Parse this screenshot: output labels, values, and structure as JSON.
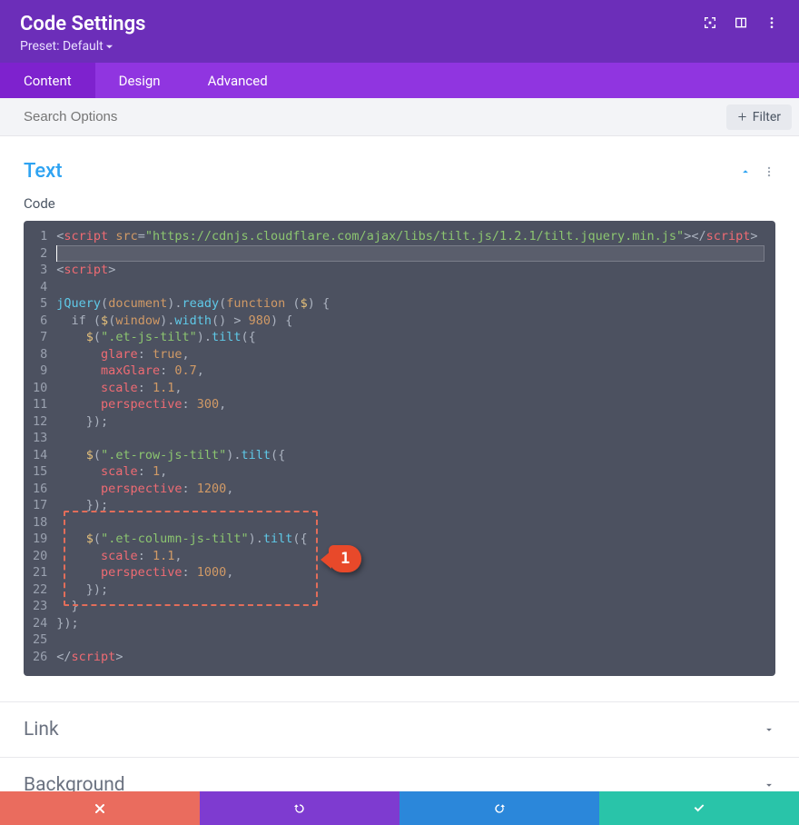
{
  "header": {
    "title": "Code Settings",
    "preset_label": "Preset: Default"
  },
  "tabs": [
    {
      "label": "Content",
      "active": true
    },
    {
      "label": "Design",
      "active": false
    },
    {
      "label": "Advanced",
      "active": false
    }
  ],
  "search": {
    "placeholder": "Search Options",
    "filter_label": "Filter"
  },
  "section_text": {
    "title": "Text",
    "code_label": "Code"
  },
  "editor": {
    "line_count": 26,
    "highlighted_line": 2,
    "lines": [
      [
        {
          "t": "<",
          "c": "gray"
        },
        {
          "t": "script",
          "c": "red"
        },
        {
          "t": " ",
          "c": "gray"
        },
        {
          "t": "src",
          "c": "orange"
        },
        {
          "t": "=",
          "c": "gray"
        },
        {
          "t": "\"https://cdnjs.cloudflare.com/ajax/libs/tilt.js/1.2.1/tilt.jquery.min.js\"",
          "c": "green"
        },
        {
          "t": "></",
          "c": "gray"
        },
        {
          "t": "script",
          "c": "red"
        },
        {
          "t": ">",
          "c": "gray"
        }
      ],
      [],
      [
        {
          "t": "<",
          "c": "gray"
        },
        {
          "t": "script",
          "c": "red"
        },
        {
          "t": ">",
          "c": "gray"
        }
      ],
      [],
      [
        {
          "t": "jQuery",
          "c": "lblue"
        },
        {
          "t": "(",
          "c": "gray"
        },
        {
          "t": "document",
          "c": "orange"
        },
        {
          "t": ").",
          "c": "gray"
        },
        {
          "t": "ready",
          "c": "lblue"
        },
        {
          "t": "(",
          "c": "gray"
        },
        {
          "t": "function",
          "c": "orange"
        },
        {
          "t": " (",
          "c": "gray"
        },
        {
          "t": "$",
          "c": "yellow"
        },
        {
          "t": ") {",
          "c": "gray"
        }
      ],
      [
        {
          "t": "  if ",
          "c": "gray"
        },
        {
          "t": "(",
          "c": "gray"
        },
        {
          "t": "$",
          "c": "yellow"
        },
        {
          "t": "(",
          "c": "gray"
        },
        {
          "t": "window",
          "c": "orange"
        },
        {
          "t": ").",
          "c": "gray"
        },
        {
          "t": "width",
          "c": "lblue"
        },
        {
          "t": "() > ",
          "c": "gray"
        },
        {
          "t": "980",
          "c": "orange"
        },
        {
          "t": ") {",
          "c": "gray"
        }
      ],
      [
        {
          "t": "    ",
          "c": "gray"
        },
        {
          "t": "$",
          "c": "yellow"
        },
        {
          "t": "(",
          "c": "gray"
        },
        {
          "t": "\".et-js-tilt\"",
          "c": "green"
        },
        {
          "t": ").",
          "c": "gray"
        },
        {
          "t": "tilt",
          "c": "lblue"
        },
        {
          "t": "({",
          "c": "gray"
        }
      ],
      [
        {
          "t": "      ",
          "c": "gray"
        },
        {
          "t": "glare",
          "c": "red"
        },
        {
          "t": ": ",
          "c": "gray"
        },
        {
          "t": "true",
          "c": "orange"
        },
        {
          "t": ",",
          "c": "gray"
        }
      ],
      [
        {
          "t": "      ",
          "c": "gray"
        },
        {
          "t": "maxGlare",
          "c": "red"
        },
        {
          "t": ": ",
          "c": "gray"
        },
        {
          "t": "0.7",
          "c": "orange"
        },
        {
          "t": ",",
          "c": "gray"
        }
      ],
      [
        {
          "t": "      ",
          "c": "gray"
        },
        {
          "t": "scale",
          "c": "red"
        },
        {
          "t": ": ",
          "c": "gray"
        },
        {
          "t": "1.1",
          "c": "orange"
        },
        {
          "t": ",",
          "c": "gray"
        }
      ],
      [
        {
          "t": "      ",
          "c": "gray"
        },
        {
          "t": "perspective",
          "c": "red"
        },
        {
          "t": ": ",
          "c": "gray"
        },
        {
          "t": "300",
          "c": "orange"
        },
        {
          "t": ",",
          "c": "gray"
        }
      ],
      [
        {
          "t": "    });",
          "c": "gray"
        }
      ],
      [],
      [
        {
          "t": "    ",
          "c": "gray"
        },
        {
          "t": "$",
          "c": "yellow"
        },
        {
          "t": "(",
          "c": "gray"
        },
        {
          "t": "\".et-row-js-tilt\"",
          "c": "green"
        },
        {
          "t": ").",
          "c": "gray"
        },
        {
          "t": "tilt",
          "c": "lblue"
        },
        {
          "t": "({",
          "c": "gray"
        }
      ],
      [
        {
          "t": "      ",
          "c": "gray"
        },
        {
          "t": "scale",
          "c": "red"
        },
        {
          "t": ": ",
          "c": "gray"
        },
        {
          "t": "1",
          "c": "orange"
        },
        {
          "t": ",",
          "c": "gray"
        }
      ],
      [
        {
          "t": "      ",
          "c": "gray"
        },
        {
          "t": "perspective",
          "c": "red"
        },
        {
          "t": ": ",
          "c": "gray"
        },
        {
          "t": "1200",
          "c": "orange"
        },
        {
          "t": ",",
          "c": "gray"
        }
      ],
      [
        {
          "t": "    });",
          "c": "gray"
        }
      ],
      [],
      [
        {
          "t": "    ",
          "c": "gray"
        },
        {
          "t": "$",
          "c": "yellow"
        },
        {
          "t": "(",
          "c": "gray"
        },
        {
          "t": "\".et-column-js-tilt\"",
          "c": "green"
        },
        {
          "t": ").",
          "c": "gray"
        },
        {
          "t": "tilt",
          "c": "lblue"
        },
        {
          "t": "({",
          "c": "gray"
        }
      ],
      [
        {
          "t": "      ",
          "c": "gray"
        },
        {
          "t": "scale",
          "c": "red"
        },
        {
          "t": ": ",
          "c": "gray"
        },
        {
          "t": "1.1",
          "c": "orange"
        },
        {
          "t": ",",
          "c": "gray"
        }
      ],
      [
        {
          "t": "      ",
          "c": "gray"
        },
        {
          "t": "perspective",
          "c": "red"
        },
        {
          "t": ": ",
          "c": "gray"
        },
        {
          "t": "1000",
          "c": "orange"
        },
        {
          "t": ",",
          "c": "gray"
        }
      ],
      [
        {
          "t": "    });",
          "c": "gray"
        }
      ],
      [
        {
          "t": "  }",
          "c": "gray"
        }
      ],
      [
        {
          "t": "});",
          "c": "gray"
        }
      ],
      [],
      [
        {
          "t": "</",
          "c": "gray"
        },
        {
          "t": "script",
          "c": "red"
        },
        {
          "t": ">",
          "c": "gray"
        }
      ]
    ]
  },
  "annotation": {
    "marker_text": "1",
    "box_start_line": 18,
    "box_end_line": 23
  },
  "accordions": [
    {
      "title": "Link"
    },
    {
      "title": "Background"
    }
  ],
  "footer_buttons": [
    {
      "name": "cancel",
      "color": "red"
    },
    {
      "name": "undo",
      "color": "purple"
    },
    {
      "name": "redo",
      "color": "blue"
    },
    {
      "name": "save",
      "color": "green"
    }
  ]
}
